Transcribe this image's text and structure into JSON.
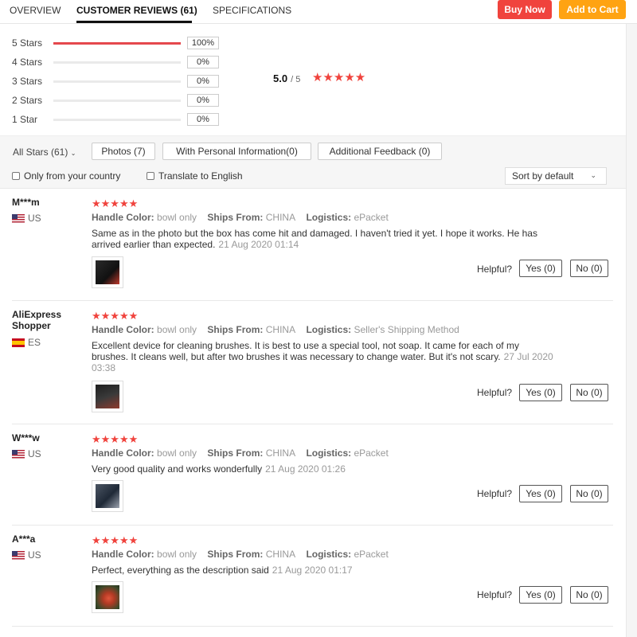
{
  "tabs": {
    "overview": "OVERVIEW",
    "reviews": "CUSTOMER REVIEWS (61)",
    "specifications": "SPECIFICATIONS"
  },
  "actions": {
    "buy_now": "Buy Now",
    "add_to_cart": "Add to Cart"
  },
  "summary": {
    "ratings": [
      {
        "label": "5 Stars",
        "percent": "100%",
        "fraction": 1.0
      },
      {
        "label": "4 Stars",
        "percent": "0%",
        "fraction": 0
      },
      {
        "label": "3 Stars",
        "percent": "0%",
        "fraction": 0
      },
      {
        "label": "2 Stars",
        "percent": "0%",
        "fraction": 0
      },
      {
        "label": "1 Star",
        "percent": "0%",
        "fraction": 0
      }
    ],
    "average": "5.0",
    "out_of": "/ 5",
    "stars": "★★★★★"
  },
  "filters": {
    "all_stars": "All Stars (61)",
    "photos": "Photos (7)",
    "personal_info": "With Personal Information(0)",
    "additional": "Additional Feedback (0)",
    "only_country": "Only from your country",
    "translate": "Translate to English",
    "sort": "Sort by default"
  },
  "labels": {
    "handle_color": "Handle Color:",
    "ships_from": "Ships From:",
    "logistics": "Logistics:",
    "helpful": "Helpful?"
  },
  "reviews": [
    {
      "user": "M***m",
      "country": "US",
      "stars": "★★★★★",
      "handle_color": "bowl only",
      "ships_from": "CHINA",
      "logistics": "ePacket",
      "text": "Same as in the photo but the box has come hit and damaged. I haven't tried it yet. I hope it works. He has arrived earlier than expected.",
      "date": "21 Aug 2020 01:14",
      "yes": "Yes (0)",
      "no": "No (0)"
    },
    {
      "user": "AliExpress Shopper",
      "country": "ES",
      "stars": "★★★★★",
      "handle_color": "bowl only",
      "ships_from": "CHINA",
      "logistics": "Seller's Shipping Method",
      "text": "Excellent device for cleaning brushes. It is best to use a special tool, not soap. It came for each of my brushes. It cleans well, but after two brushes it was necessary to change water. But it's not scary.",
      "date": "27 Jul 2020 03:38",
      "yes": "Yes (0)",
      "no": "No (0)"
    },
    {
      "user": "W***w",
      "country": "US",
      "stars": "★★★★★",
      "handle_color": "bowl only",
      "ships_from": "CHINA",
      "logistics": "ePacket",
      "text": "Very good quality and works wonderfully",
      "date": "21 Aug 2020 01:26",
      "yes": "Yes (0)",
      "no": "No (0)"
    },
    {
      "user": "A***a",
      "country": "US",
      "stars": "★★★★★",
      "handle_color": "bowl only",
      "ships_from": "CHINA",
      "logistics": "ePacket",
      "text": "Perfect, everything as the description said",
      "date": "21 Aug 2020 01:17",
      "yes": "Yes (0)",
      "no": "No (0)"
    }
  ],
  "colors": {
    "accent_red": "#f0433d",
    "accent_orange": "#ffa312"
  }
}
